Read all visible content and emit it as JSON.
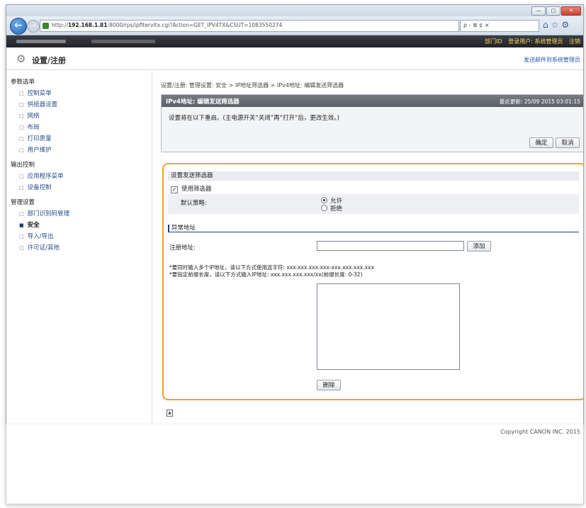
{
  "browser": {
    "url_prefix": "http://",
    "url_host": "192.168.1.81",
    "url_rest": ":8000/rps/ipfltervitx.cgi?Action=GET_IPV4TX&CSUT=1083550274",
    "search_text": "ρ - ≣ ¢ ×",
    "min_label": "—",
    "max_label": "□",
    "close_label": "✕"
  },
  "header": {
    "links": [
      "部门ID",
      "登录用户: 系统管理员",
      "注销"
    ]
  },
  "app": {
    "title": "设置/注册",
    "mail_link": "发送邮件到系统管理员"
  },
  "sidebar": {
    "sections": [
      {
        "heading": "参数选单",
        "items": [
          "控制菜单",
          "供纸器设置",
          "网络",
          "布局",
          "打印质量",
          "用户维护"
        ]
      },
      {
        "heading": "输出控制",
        "items": [
          "应用程序菜单",
          "设备控制"
        ]
      },
      {
        "heading": "管理设置",
        "items": [
          "部门识别码管理",
          "安全",
          "导入/导出",
          "许可证/其他"
        ]
      }
    ],
    "active": "安全"
  },
  "main": {
    "breadcrumb": "设置/注册: 管理设置: 安全 > IP地址筛选器 > IPv4地址: 编辑发送筛选器",
    "panel_title": "IPv4地址: 编辑发送筛选器",
    "last_updated": "最近更新: 25/09 2015 03:01:15",
    "notice": "设置将在以下重启。(主电源开关“关闭”再“打开”后，更改生效。)",
    "ok_label": "确定",
    "cancel_label": "取消"
  },
  "form": {
    "section_title": "设置发送筛选器",
    "use_filter_label": "使用筛选器",
    "use_filter_checked": true,
    "default_policy_label": "默认策略:",
    "policy_options": [
      "允许",
      "拒绝"
    ],
    "policy_selected": "允许",
    "exception_heading": "异常地址",
    "register_label": "注册地址:",
    "register_value": "",
    "add_label": "添加",
    "note_line1": "*要同时输入多个IP地址，请以下方式使用连字符: xxx.xxx.xxx.xxx-xxx.xxx.xxx.xxx",
    "note_line2": "*要指定前缀长度，请以下方式输入IP地址: xxx.xxx.xxx.xxx/xx(前缀长度: 0-32)",
    "delete_label": "删除"
  },
  "footer": {
    "copyright": "Copyright CANON INC. 2015"
  }
}
